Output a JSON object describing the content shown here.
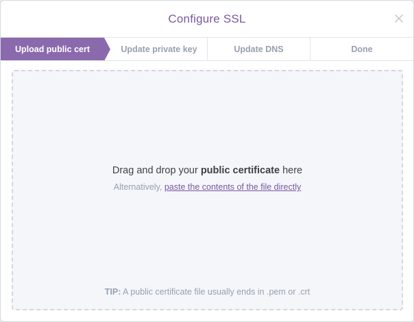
{
  "modal": {
    "title": "Configure SSL",
    "close_icon": "close-icon"
  },
  "steps": [
    {
      "label": "Upload public cert",
      "active": true
    },
    {
      "label": "Update private key",
      "active": false
    },
    {
      "label": "Update DNS",
      "active": false
    },
    {
      "label": "Done",
      "active": false
    }
  ],
  "dropzone": {
    "main_prefix": "Drag and drop your ",
    "main_bold": "public certificate",
    "main_suffix": " here",
    "alt_prefix": "Alternatively, ",
    "alt_link": "paste the contents of the file directly",
    "tip_label": "TIP:",
    "tip_text": " A public certificate file usually ends in .pem or .crt"
  },
  "colors": {
    "accent": "#79589f",
    "active_step_bg": "#8a6aad",
    "muted_text": "#96a0ae",
    "dropzone_bg": "#f5f6fa"
  }
}
